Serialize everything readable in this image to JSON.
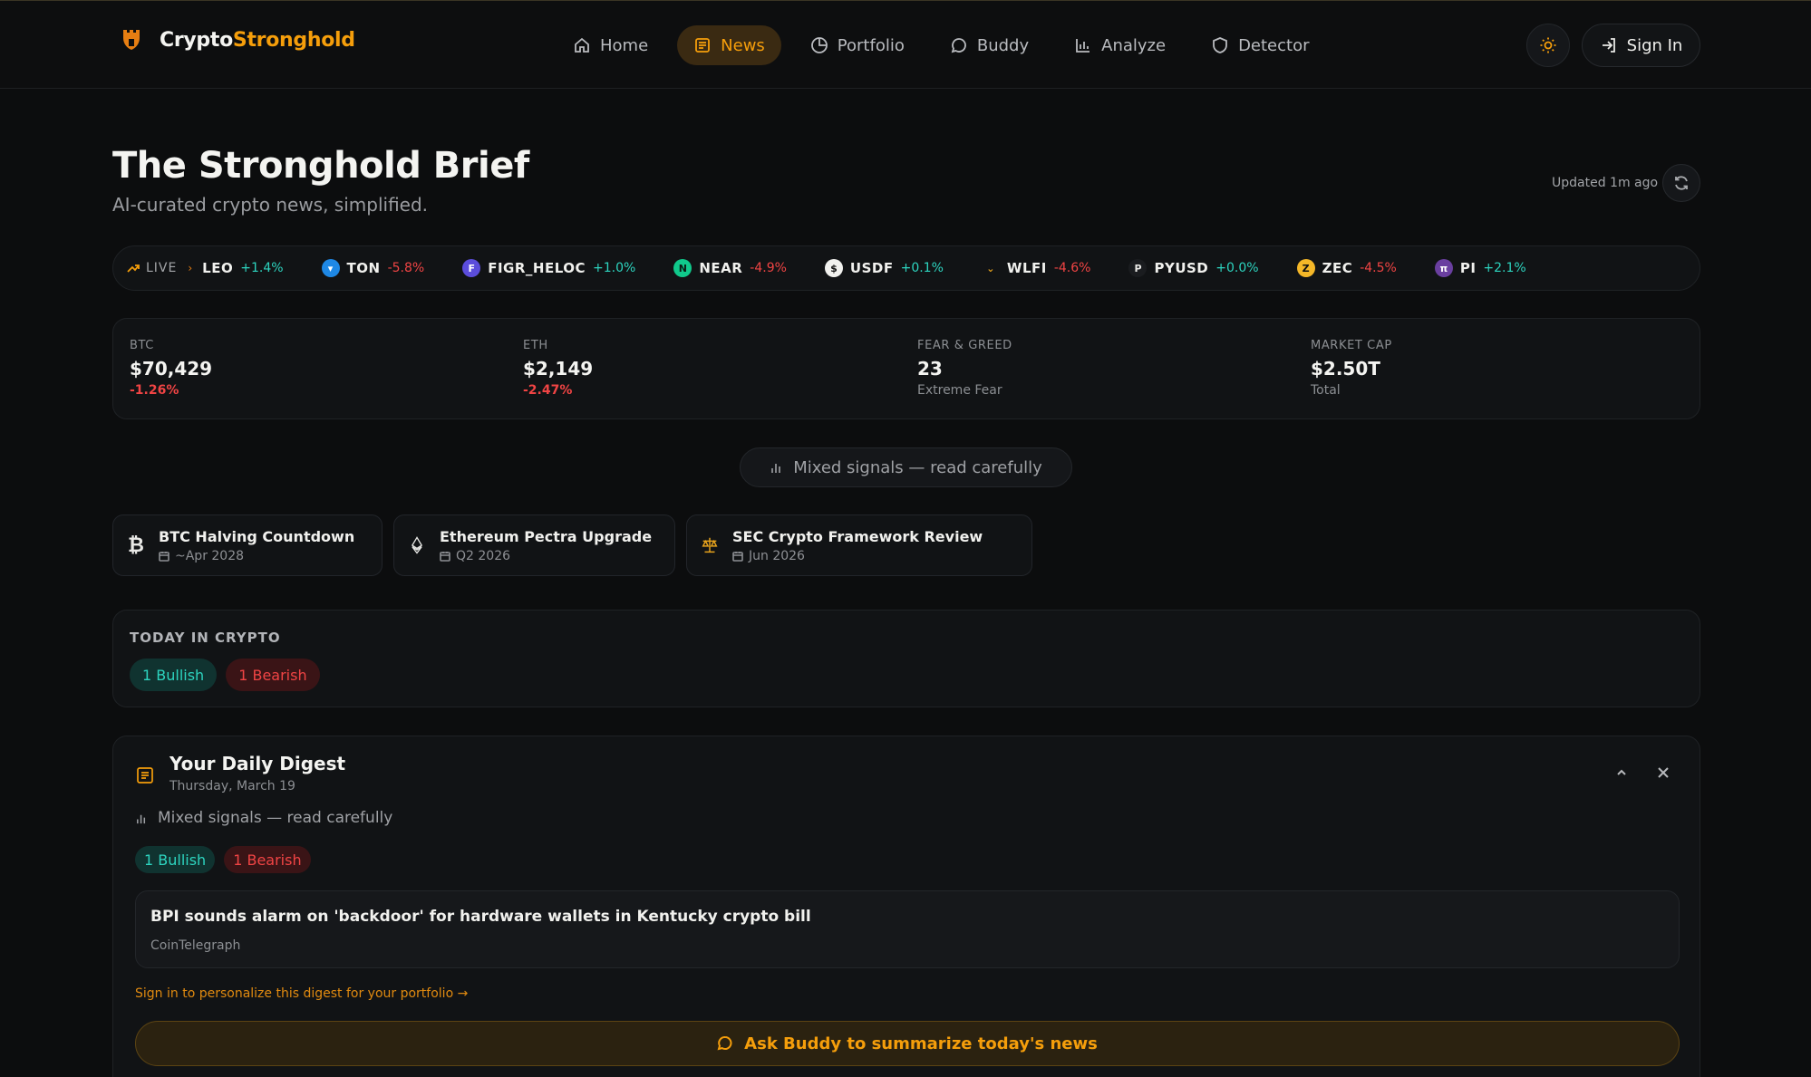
{
  "brand": {
    "name_part1": "Crypto",
    "name_part2": "Stronghold"
  },
  "nav": [
    {
      "label": "Home",
      "icon": "home-icon"
    },
    {
      "label": "News",
      "icon": "newspaper-icon",
      "active": true
    },
    {
      "label": "Portfolio",
      "icon": "pie-chart-icon"
    },
    {
      "label": "Buddy",
      "icon": "chat-bubble-icon"
    },
    {
      "label": "Analyze",
      "icon": "bar-chart-icon"
    },
    {
      "label": "Detector",
      "icon": "shield-icon"
    }
  ],
  "auth": {
    "signin_label": "Sign In"
  },
  "page": {
    "title": "The Stronghold Brief",
    "subtitle": "AI-curated crypto news, simplified.",
    "updated": "Updated 1m ago"
  },
  "ticker": {
    "live_label": "LIVE",
    "items": [
      {
        "symbol": "LEO",
        "change": "+1.4%",
        "direction": "up"
      },
      {
        "symbol": "TON",
        "change": "-5.8%",
        "direction": "down"
      },
      {
        "symbol": "FIGR_HELOC",
        "change": "+1.0%",
        "direction": "up"
      },
      {
        "symbol": "NEAR",
        "change": "-4.9%",
        "direction": "down"
      },
      {
        "symbol": "USDF",
        "change": "+0.1%",
        "direction": "up"
      },
      {
        "symbol": "WLFI",
        "change": "-4.6%",
        "direction": "down"
      },
      {
        "symbol": "PYUSD",
        "change": "+0.0%",
        "direction": "up"
      },
      {
        "symbol": "ZEC",
        "change": "-4.5%",
        "direction": "down"
      },
      {
        "symbol": "PI",
        "change": "+2.1%",
        "direction": "up"
      }
    ]
  },
  "stats": [
    {
      "label": "BTC",
      "value": "$70,429",
      "sub": "-1.26%",
      "sub_type": "down"
    },
    {
      "label": "ETH",
      "value": "$2,149",
      "sub": "-2.47%",
      "sub_type": "down"
    },
    {
      "label": "FEAR & GREED",
      "value": "23",
      "sub": "Extreme Fear",
      "sub_type": "muted"
    },
    {
      "label": "MARKET CAP",
      "value": "$2.50T",
      "sub": "Total",
      "sub_type": "muted"
    }
  ],
  "sentiment": {
    "label": "Mixed signals — read carefully"
  },
  "events": [
    {
      "name": "BTC Halving Countdown",
      "date": "~Apr 2028",
      "icon": "bitcoin-icon"
    },
    {
      "name": "Ethereum Pectra Upgrade",
      "date": "Q2 2026",
      "icon": "ethereum-icon"
    },
    {
      "name": "SEC Crypto Framework Review",
      "date": "Jun 2026",
      "icon": "scales-icon"
    }
  ],
  "today": {
    "heading": "TODAY IN CRYPTO",
    "bullish": "1 Bullish",
    "bearish": "1 Bearish"
  },
  "digest": {
    "title": "Your Daily Digest",
    "date": "Thursday, March 19",
    "mixed": "Mixed signals — read carefully",
    "bullish": "1 Bullish",
    "bearish": "1 Bearish",
    "article": {
      "title": "BPI sounds alarm on 'backdoor' for hardware wallets in Kentucky crypto bill",
      "source": "CoinTelegraph"
    },
    "personalize": "Sign in to personalize this digest for your portfolio →",
    "ask_label": "Ask Buddy to summarize today's news"
  },
  "colors": {
    "accent": "#f59e0b",
    "up": "#2dd4bf",
    "down": "#f04444",
    "background": "#0c0d0e"
  }
}
